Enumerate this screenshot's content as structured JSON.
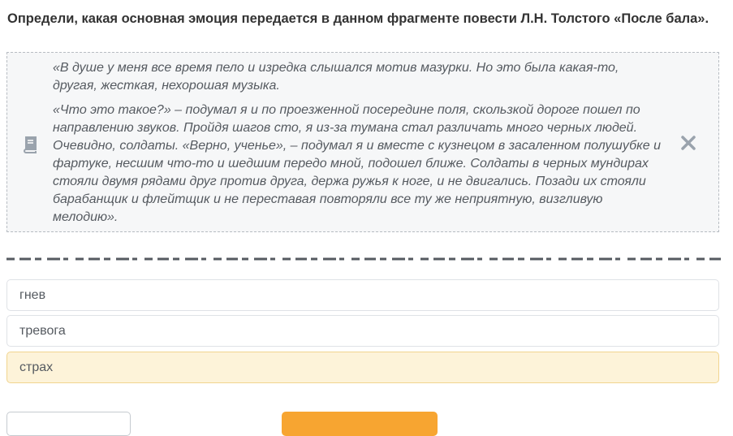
{
  "question": {
    "text": "Определи, какая основная эмоция передается в данном фрагменте повести Л.Н. Толстого «После бала»."
  },
  "passage": {
    "paragraphs": [
      "«В душе у меня все время пело и изредка слышался мотив мазурки. Но это была какая-то, другая, жесткая, нехорошая музыка.",
      "«Что это такое?» – подумал я и по проезженной посередине поля, скользкой дороге пошел по направлению звуков. Пройдя шагов сто, я из-за тумана стал различать много черных людей. Очевидно, солдаты. «Верно, ученье», – подумал я и вместе с кузнецом в засаленном полушубке и фартуке, несшим что-то и шедшим передо мной, подошел ближе. Солдаты в черных мундирах стояли двумя рядами друг против друга, держа ружья к ноге, и не двигались. Позади их стояли барабанщик и флейтщик и не переставая повторяли все ту же неприятную, визгливую мелодию»."
    ],
    "icon": "book-icon",
    "close_icon": "close-icon"
  },
  "options": [
    {
      "label": "гнев",
      "selected": false
    },
    {
      "label": "тревога",
      "selected": false
    },
    {
      "label": "страх",
      "selected": true
    }
  ],
  "colors": {
    "accent": "#f7a531",
    "selected_bg": "#fdf3d9",
    "icon": "#9aa3ad"
  }
}
